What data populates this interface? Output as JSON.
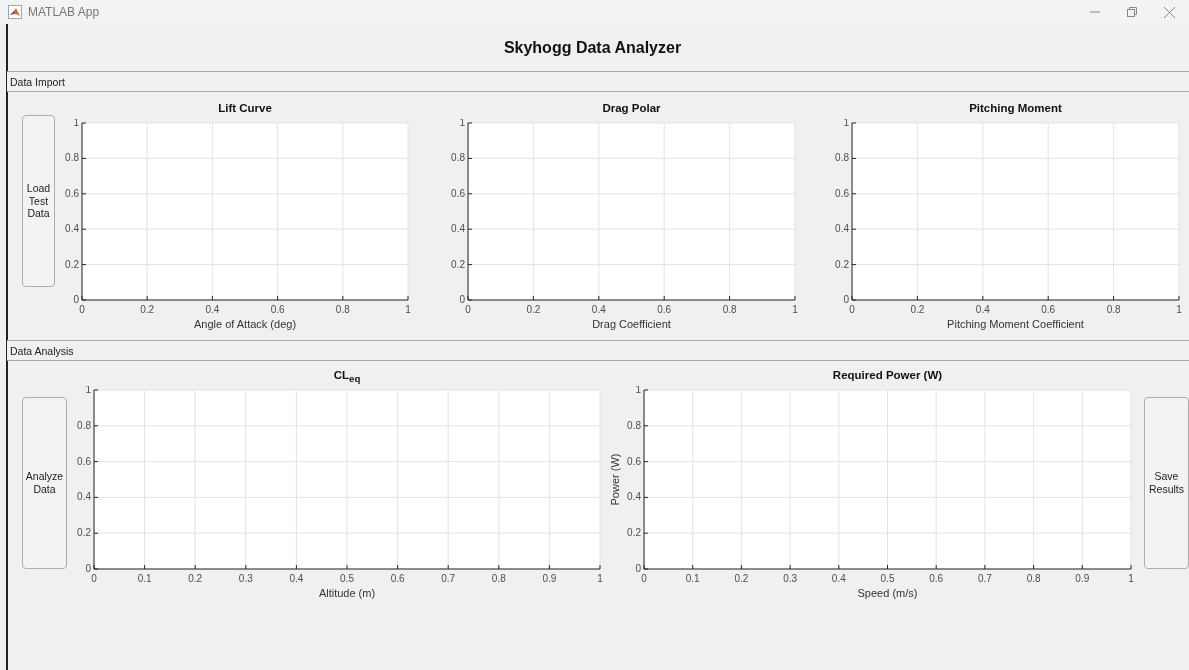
{
  "window": {
    "title": "MATLAB App"
  },
  "header": "Skyhogg Data Analyzer",
  "panels": [
    {
      "title": "Data Import",
      "items": [
        {
          "kind": "button",
          "label": "Load Test Data"
        },
        {
          "kind": "chart",
          "chart_data": {
            "type": "line",
            "title": "Lift Curve",
            "grid": true,
            "xlabel": "Angle of Attack (deg)",
            "xlim": [
              0,
              1
            ],
            "ylim": [
              0,
              1
            ],
            "xticks": [
              0,
              0.2,
              0.4,
              0.6,
              0.8,
              1
            ],
            "yticks": [
              0,
              0.2,
              0.4,
              0.6,
              0.8,
              1
            ]
          }
        },
        {
          "kind": "chart",
          "chart_data": {
            "type": "line",
            "title": "Drag Polar",
            "grid": true,
            "xlabel": "Drag Coefficient",
            "xlim": [
              0,
              1
            ],
            "ylim": [
              0,
              1
            ],
            "xticks": [
              0,
              0.2,
              0.4,
              0.6,
              0.8,
              1
            ],
            "yticks": [
              0,
              0.2,
              0.4,
              0.6,
              0.8,
              1
            ]
          }
        },
        {
          "kind": "chart",
          "chart_data": {
            "type": "line",
            "title": "Pitching Moment",
            "grid": true,
            "xlabel": "Pitching Moment Coefficient",
            "xlim": [
              0,
              1
            ],
            "ylim": [
              0,
              1
            ],
            "xticks": [
              0,
              0.2,
              0.4,
              0.6,
              0.8,
              1
            ],
            "yticks": [
              0,
              0.2,
              0.4,
              0.6,
              0.8,
              1
            ]
          }
        }
      ]
    },
    {
      "title": "Data Analysis",
      "items": [
        {
          "kind": "button",
          "label": "Analyze Data"
        },
        {
          "kind": "chart",
          "chart_data": {
            "type": "line",
            "title": "CL$_{eq}$",
            "grid": true,
            "xlabel": "Altitude (m)",
            "xlim": [
              0,
              1
            ],
            "ylim": [
              0,
              1
            ],
            "xticks": [
              0,
              0.1,
              0.2,
              0.3,
              0.4,
              0.5,
              0.6,
              0.7,
              0.8,
              0.9,
              1
            ],
            "yticks": [
              0,
              0.2,
              0.4,
              0.6,
              0.8,
              1
            ]
          }
        },
        {
          "kind": "chart",
          "chart_data": {
            "type": "line",
            "title": "Required Power (W)",
            "grid": true,
            "xlabel": "Speed (m/s)",
            "ylabel": "Power (W)",
            "xlim": [
              0,
              1
            ],
            "ylim": [
              0,
              1
            ],
            "xticks": [
              0,
              0.1,
              0.2,
              0.3,
              0.4,
              0.5,
              0.6,
              0.7,
              0.8,
              0.9,
              1
            ],
            "yticks": [
              0,
              0.2,
              0.4,
              0.6,
              0.8,
              1
            ]
          }
        },
        {
          "kind": "button",
          "label": "Save Results"
        }
      ]
    }
  ]
}
